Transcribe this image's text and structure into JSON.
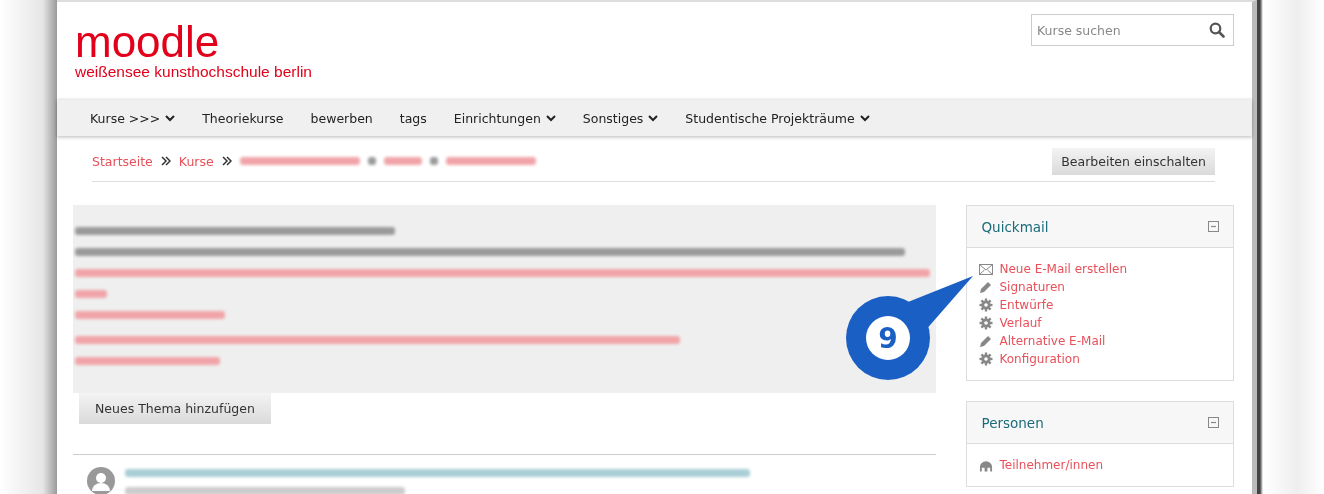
{
  "logo": {
    "title": "moodle",
    "subtitle": "weißensee kunsthochschule berlin"
  },
  "search": {
    "placeholder": "Kurse suchen"
  },
  "nav": [
    {
      "label": "Kurse >>>",
      "dropdown": true
    },
    {
      "label": "Theoriekurse",
      "dropdown": false
    },
    {
      "label": "bewerben",
      "dropdown": false
    },
    {
      "label": "tags",
      "dropdown": false
    },
    {
      "label": "Einrichtungen",
      "dropdown": true
    },
    {
      "label": "Sonstiges",
      "dropdown": true
    },
    {
      "label": "Studentische Projekträume",
      "dropdown": true
    }
  ],
  "breadcrumb": [
    "Startseite",
    "Kurse"
  ],
  "edit_button": "Bearbeiten einschalten",
  "new_topic_button": "Neues Thema hinzufügen",
  "blocks": [
    {
      "title": "Quickmail",
      "items": [
        {
          "label": "Neue E-Mail erstellen",
          "kind": "mail"
        },
        {
          "label": "Signaturen",
          "kind": "pencil"
        },
        {
          "label": "Entwürfe",
          "kind": "gear"
        },
        {
          "label": "Verlauf",
          "kind": "gear"
        },
        {
          "label": "Alternative E-Mail",
          "kind": "pencil"
        },
        {
          "label": "Konfiguration",
          "kind": "gear"
        }
      ]
    },
    {
      "title": "Personen",
      "items": [
        {
          "label": "Teilnehmer/innen",
          "kind": "people"
        }
      ]
    }
  ],
  "callout": {
    "label": "9"
  }
}
